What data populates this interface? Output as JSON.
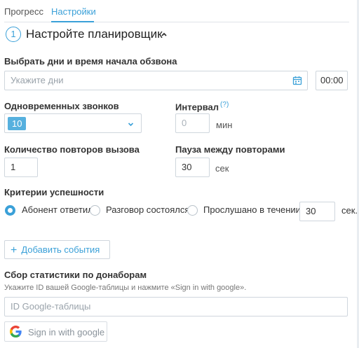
{
  "tabs": [
    {
      "label": "Прогресс",
      "active": false
    },
    {
      "label": "Настройки",
      "active": true
    }
  ],
  "section": {
    "step": "1",
    "title": "Настройте планировщик"
  },
  "schedule": {
    "label": "Выбрать дни и время начала обзвона",
    "days_placeholder": "Укажите дни",
    "time_value": "00:00"
  },
  "concurrent": {
    "label": "Одновременных звонков",
    "value": "10"
  },
  "interval": {
    "label": "Интервал",
    "help": "(?)",
    "placeholder": "0",
    "unit": "мин"
  },
  "retries": {
    "label": "Количество повторов вызова",
    "value": "1"
  },
  "pause": {
    "label": "Пауза между повторами",
    "value": "30",
    "unit": "сек"
  },
  "success": {
    "label": "Критерии успешности",
    "options": [
      {
        "label": "Абонент ответил",
        "checked": true
      },
      {
        "label": "Разговор состоялся",
        "checked": false
      },
      {
        "label": "Прослушано в течении",
        "checked": false
      }
    ],
    "listened_value": "30",
    "listened_unit": "сек."
  },
  "add_events": {
    "label": "Добавить события"
  },
  "donations": {
    "label": "Сбор статистики по донаборам",
    "hint": "Укажите ID вашей Google-таблицы и нажмите «Sign in with google».",
    "sheet_placeholder": "ID Google-таблицы",
    "google_button": "Sign in with google"
  },
  "icons": {
    "calendar": "calendar-icon",
    "chevron_up": "chevron-up-icon",
    "chevron_down": "chevron-down-icon",
    "plus": "plus-icon",
    "google": "google-g-icon"
  },
  "colors": {
    "accent": "#3aa0d8",
    "chip": "#56b0de",
    "border": "#cfd6dd"
  }
}
